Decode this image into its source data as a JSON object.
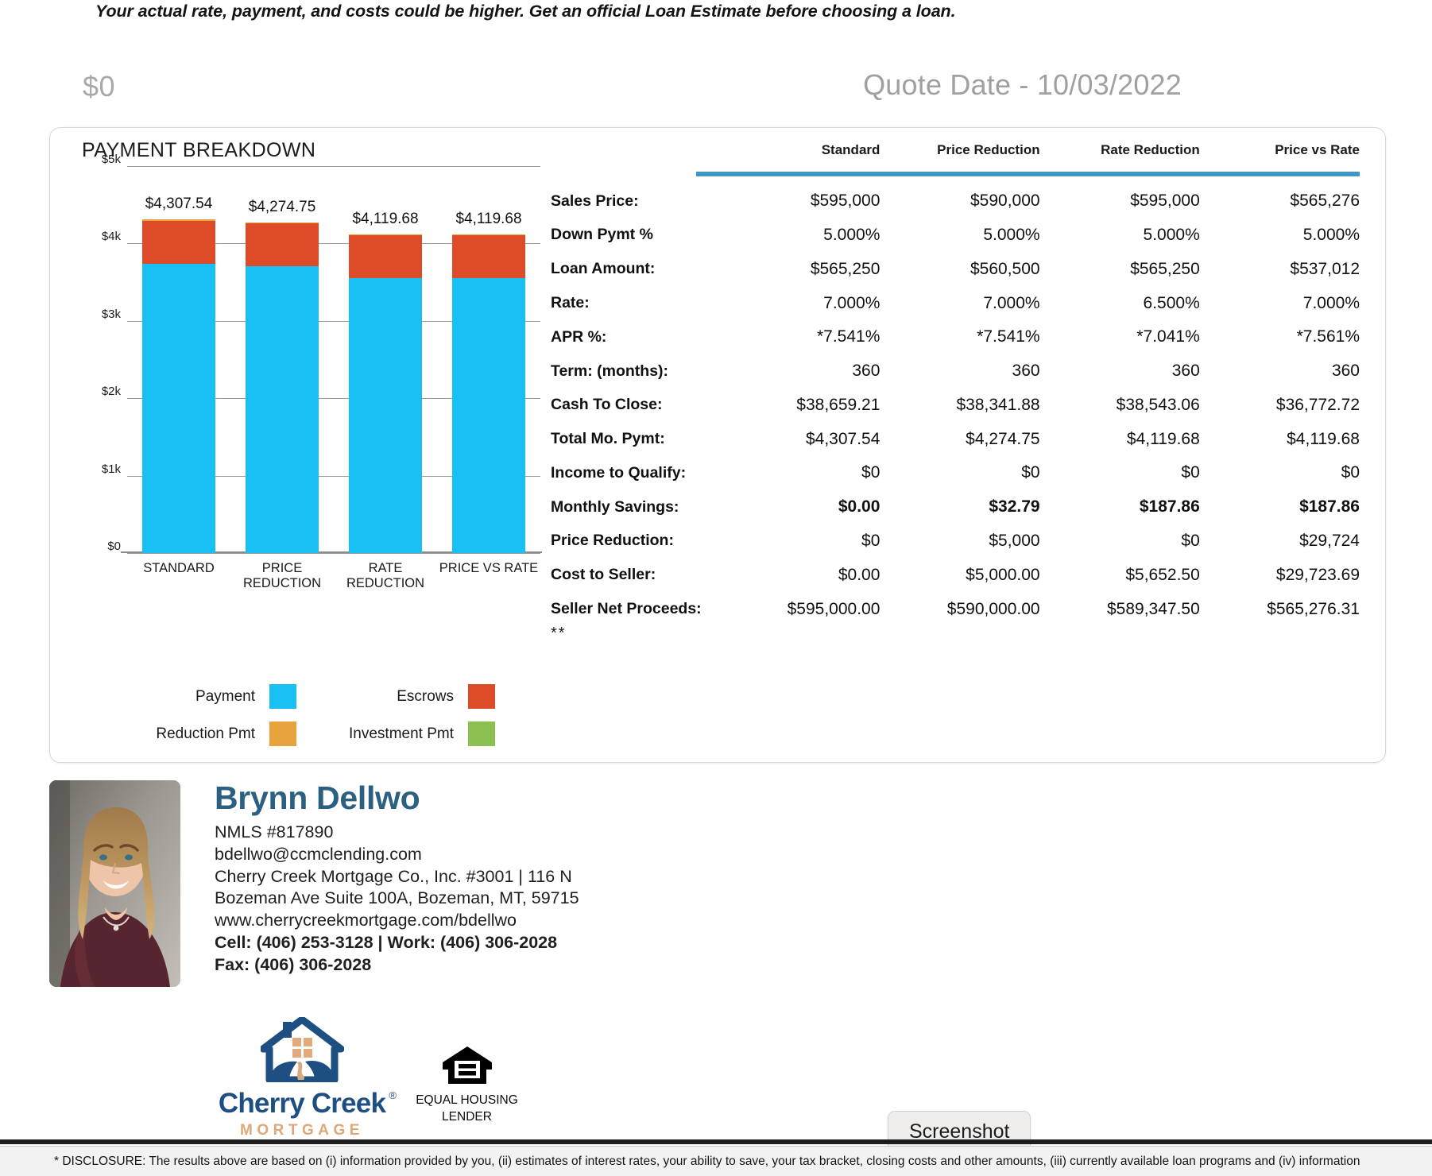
{
  "header": {
    "disclaimer": "Your actual rate, payment, and costs could be higher. Get an official Loan Estimate before choosing a loan.",
    "amount_zero": "$0",
    "quote_date": "Quote Date - 10/03/2022"
  },
  "chart_data": {
    "type": "bar",
    "title": "PAYMENT BREAKDOWN",
    "xlabel": "",
    "ylabel": "",
    "stacked": true,
    "grid": true,
    "ylim": [
      0,
      5000
    ],
    "ytick_labels": [
      "$5k",
      "$4k",
      "$3k",
      "$2k",
      "$1k",
      "$0"
    ],
    "ytick_values": [
      5000,
      4000,
      3000,
      2000,
      1000,
      0
    ],
    "categories": [
      "STANDARD",
      "PRICE REDUCTION",
      "RATE REDUCTION",
      "PRICE VS RATE"
    ],
    "data_labels": [
      "$4,307.54",
      "$4,274.75",
      "$4,119.68",
      "$4,119.68"
    ],
    "totals": [
      4307.54,
      4274.75,
      4119.68,
      4119.68
    ],
    "series": [
      {
        "name": "Payment",
        "color": "#19c0f4",
        "values": [
          3740.54,
          3707.75,
          3552.68,
          3552.68
        ]
      },
      {
        "name": "Escrows",
        "color": "#dd4b28",
        "values": [
          552.0,
          552.0,
          552.0,
          552.0
        ]
      },
      {
        "name": "Reduction Pmt",
        "color": "#e8a33d",
        "values": [
          15.0,
          15.0,
          15.0,
          15.0
        ]
      },
      {
        "name": "Investment Pmt",
        "color": "#8cc152",
        "values": [
          0,
          0,
          0,
          0
        ]
      }
    ],
    "legend_position": "bottom",
    "legend": [
      {
        "label": "Payment",
        "color": "#19c0f4"
      },
      {
        "label": "Escrows",
        "color": "#dd4b28"
      },
      {
        "label": "Reduction Pmt",
        "color": "#e8a33d"
      },
      {
        "label": "Investment Pmt",
        "color": "#8cc152"
      }
    ]
  },
  "comparison": {
    "row_label_header": "",
    "columns": [
      "Standard",
      "Price Reduction",
      "Rate Reduction",
      "Price vs Rate"
    ],
    "accent_color": "#4196c4",
    "positive_color": "#36a047",
    "negative_color": "#cc1418",
    "footnote": "**",
    "rows": [
      {
        "label": "Sales Price:",
        "values": [
          "$595,000",
          "$590,000",
          "$595,000",
          "$565,276"
        ]
      },
      {
        "label": "Down Pymt %",
        "values": [
          "5.000%",
          "5.000%",
          "5.000%",
          "5.000%"
        ]
      },
      {
        "label": "Loan Amount:",
        "values": [
          "$565,250",
          "$560,500",
          "$565,250",
          "$537,012"
        ]
      },
      {
        "label": "Rate:",
        "values": [
          "7.000%",
          "7.000%",
          "6.500%",
          "7.000%"
        ]
      },
      {
        "label": "APR %:",
        "values": [
          "*7.541%",
          "*7.541%",
          "*7.041%",
          "*7.561%"
        ]
      },
      {
        "label": "Term: (months):",
        "values": [
          "360",
          "360",
          "360",
          "360"
        ]
      },
      {
        "label": "Cash To Close:",
        "values": [
          "$38,659.21",
          "$38,341.88",
          "$38,543.06",
          "$36,772.72"
        ]
      },
      {
        "label": "Total Mo. Pymt:",
        "values": [
          "$4,307.54",
          "$4,274.75",
          "$4,119.68",
          "$4,119.68"
        ]
      },
      {
        "label": "Income to Qualify:",
        "values": [
          "$0",
          "$0",
          "$0",
          "$0"
        ]
      },
      {
        "label": "Monthly Savings:",
        "values": [
          "$0.00",
          "$32.79",
          "$187.86",
          "$187.86"
        ],
        "styles": [
          "neg",
          "pos",
          "pos",
          "pos"
        ]
      },
      {
        "label": "Price Reduction:",
        "values": [
          "$0",
          "$5,000",
          "$0",
          "$29,724"
        ]
      },
      {
        "label": "Cost to Seller:",
        "values": [
          "$0.00",
          "$5,000.00",
          "$5,652.50",
          "$29,723.69"
        ]
      },
      {
        "label": "Seller Net Proceeds:",
        "values": [
          "$595,000.00",
          "$590,000.00",
          "$589,347.50",
          "$565,276.31"
        ]
      }
    ]
  },
  "agent": {
    "name": "Brynn Dellwo",
    "nmls": "NMLS #817890",
    "email": "bdellwo@ccmclending.com",
    "company_line1": "Cherry Creek Mortgage Co., Inc. #3001 | 116 N",
    "company_line2": "Bozeman Ave Suite 100A, Bozeman, MT, 59715",
    "website": "www.cherrycreekmortgage.com/bdellwo",
    "phones": "Cell: (406) 253-3128 | Work: (406) 306-2028",
    "fax": "Fax: (406) 306-2028"
  },
  "brand": {
    "name": "Cherry Creek",
    "registered": "®",
    "subtitle": "MORTGAGE",
    "equal_housing_line1": "EQUAL HOUSING",
    "equal_housing_line2": "LENDER"
  },
  "overlay": {
    "tooltip": "Screenshot"
  },
  "footer": {
    "disclosure": "* DISCLOSURE: The results above are based on (i) information provided by you, (ii) estimates of interest rates, your ability to save, your tax bracket, closing costs and other amounts, (iii) currently available loan programs and (iv) information"
  }
}
